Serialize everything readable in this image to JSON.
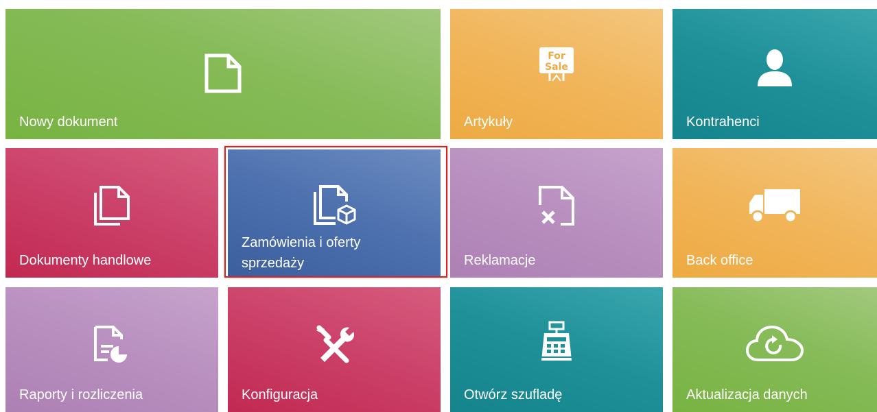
{
  "tiles": [
    {
      "label": "Nowy dokument",
      "icon": "new-document-icon"
    },
    {
      "label": "Artykuły",
      "icon": "for-sale-sign-icon",
      "sign_text_1": "For",
      "sign_text_2": "Sale"
    },
    {
      "label": "Kontrahenci",
      "icon": "person-icon"
    },
    {
      "label": "Dokumenty handlowe",
      "icon": "documents-stack-icon"
    },
    {
      "label_line1": "Zamówienia i oferty",
      "label_line2": "sprzedaży",
      "icon": "documents-package-icon",
      "selected": true
    },
    {
      "label": "Reklamacje",
      "icon": "document-reject-icon"
    },
    {
      "label": "Back office",
      "icon": "truck-icon"
    },
    {
      "label": "Raporty i rozliczenia",
      "icon": "report-icon"
    },
    {
      "label": "Konfiguracja",
      "icon": "tools-icon"
    },
    {
      "label": "Otwórz szufladę",
      "icon": "cash-register-icon"
    },
    {
      "label": "Aktualizacja danych",
      "icon": "cloud-refresh-icon"
    }
  ],
  "colors": {
    "green": "#86bb58",
    "orange": "#f1b55a",
    "teal": "#1f9098",
    "crimson": "#cb4068",
    "blue": "#4d70ae",
    "purple": "#b88fbf",
    "selection_border": "#e01e1e"
  }
}
